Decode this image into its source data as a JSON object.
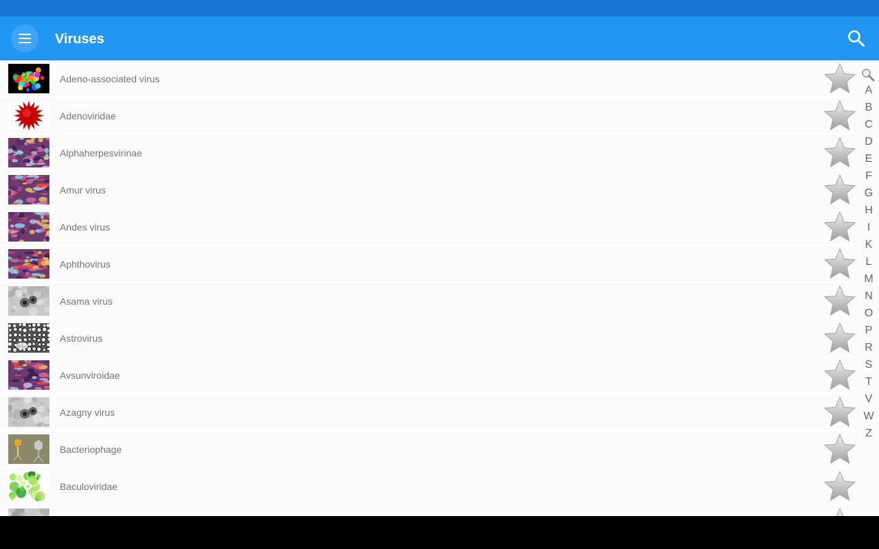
{
  "app_bar": {
    "title": "Viruses",
    "menu_icon": "menu-icon",
    "search_icon": "search-icon",
    "color": "#2196F3",
    "status_color": "#1976D2"
  },
  "list": {
    "items": [
      {
        "label": "Adeno-associated virus",
        "thumb": "colorful-capsid"
      },
      {
        "label": "Adenoviridae",
        "thumb": "red-spiky-virion"
      },
      {
        "label": "Alphaherpesvirinae",
        "thumb": "purple-micrograph"
      },
      {
        "label": "Amur virus",
        "thumb": "purple-micrograph"
      },
      {
        "label": "Andes virus",
        "thumb": "purple-micrograph"
      },
      {
        "label": "Aphthovirus",
        "thumb": "purple-micrograph"
      },
      {
        "label": "Asama virus",
        "thumb": "gray-micrograph"
      },
      {
        "label": "Astrovirus",
        "thumb": "dotted-micrograph"
      },
      {
        "label": "Avsunviroidae",
        "thumb": "purple-micrograph"
      },
      {
        "label": "Azagny virus",
        "thumb": "gray-micrograph"
      },
      {
        "label": "Bacteriophage",
        "thumb": "phage-illustration"
      },
      {
        "label": "Baculoviridae",
        "thumb": "green-cells"
      },
      {
        "label": "",
        "thumb": "gray-micrograph"
      }
    ],
    "favorite_icon": "star-icon"
  },
  "index_bar": {
    "search_icon": "magnifier-icon",
    "letters": [
      "A",
      "B",
      "C",
      "D",
      "E",
      "F",
      "G",
      "H",
      "I",
      "K",
      "L",
      "M",
      "N",
      "O",
      "P",
      "R",
      "S",
      "T",
      "V",
      "W",
      "Z"
    ]
  }
}
